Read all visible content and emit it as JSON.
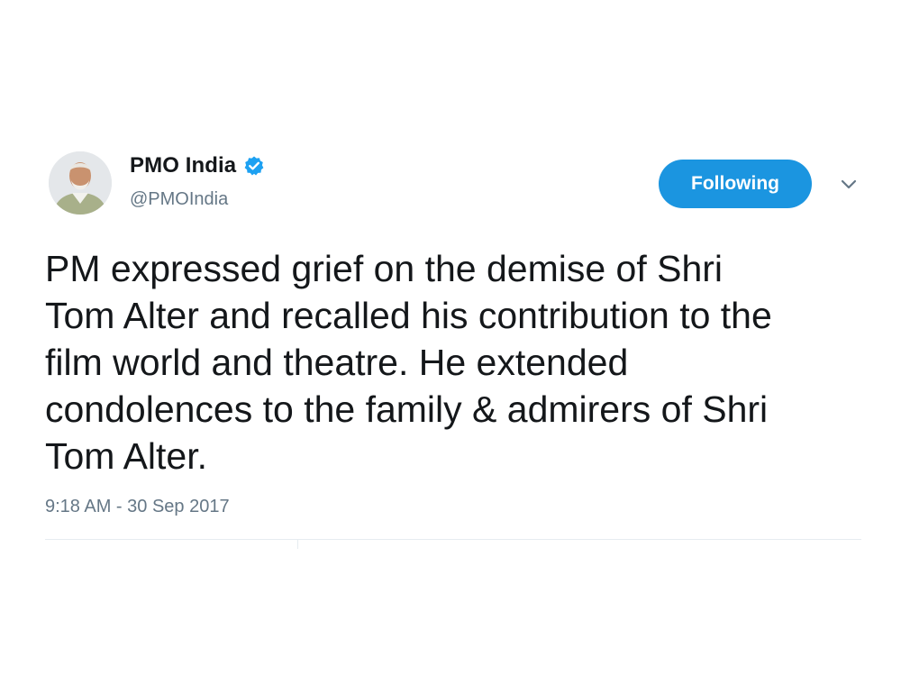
{
  "user": {
    "display_name": "PMO India",
    "handle": "@PMOIndia",
    "verified": true,
    "avatar_icon": "profile-photo"
  },
  "follow_button": {
    "label": "Following",
    "color": "#1b95e0"
  },
  "tweet": {
    "text": "PM expressed grief on the demise of Shri\nTom Alter and recalled his contribution to the\nfilm world and theatre. He extended\ncondolences to the family & admirers of Shri\nTom Alter.",
    "timestamp": "9:18 AM - 30 Sep 2017"
  },
  "icons": {
    "verified": "verified-badge-icon",
    "menu": "chevron-down-icon"
  }
}
